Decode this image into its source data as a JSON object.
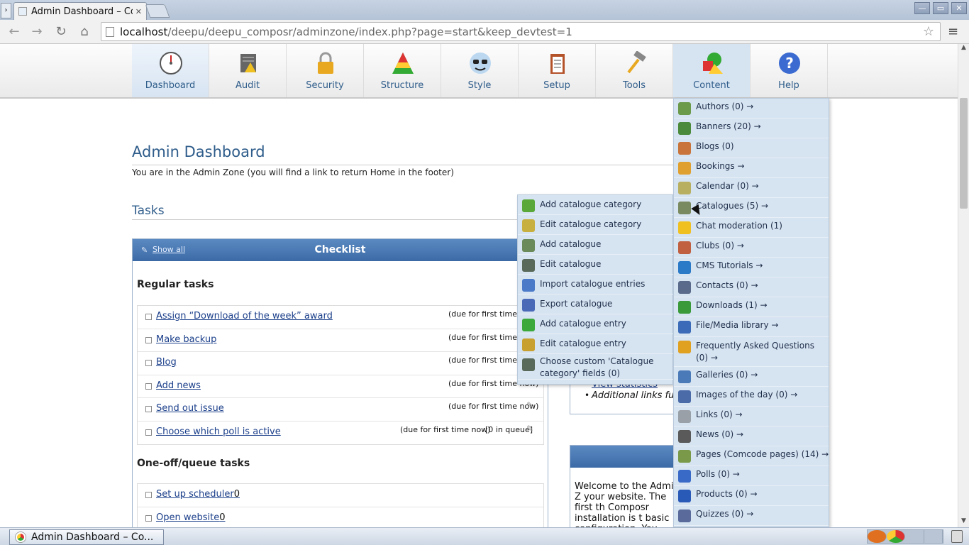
{
  "browser": {
    "tab_title": "Admin Dashboard – Co",
    "url_host": "localhost",
    "url_path": "/deepu/deepu_composr/adminzone/index.php?page=start&keep_devtest=1",
    "window_buttons": [
      "—",
      "▭",
      "✕"
    ]
  },
  "admin_nav": [
    {
      "label": "Dashboard",
      "icon": "dashboard-gauge-icon"
    },
    {
      "label": "Audit",
      "icon": "audit-icon"
    },
    {
      "label": "Security",
      "icon": "padlock-icon"
    },
    {
      "label": "Structure",
      "icon": "structure-triangle-icon"
    },
    {
      "label": "Style",
      "icon": "style-sunglasses-icon"
    },
    {
      "label": "Setup",
      "icon": "setup-clipboard-icon"
    },
    {
      "label": "Tools",
      "icon": "tools-hammer-icon"
    },
    {
      "label": "Content",
      "icon": "content-shapes-icon"
    },
    {
      "label": "Help",
      "icon": "help-question-icon"
    }
  ],
  "page": {
    "title": "Admin Dashboard",
    "subtitle": "You are in the Admin Zone (you will find a link to return Home in the footer)",
    "tasks_heading": "Tasks"
  },
  "checklist": {
    "show_all": "Show all",
    "title": "Checklist",
    "regular_heading": "Regular tasks",
    "regular_tasks": [
      {
        "label": "Assign “Download of the week” award",
        "due": "(due for first time now)",
        "queue": ""
      },
      {
        "label": "Make backup",
        "due": "(due for first time now)",
        "queue": ""
      },
      {
        "label": "Blog",
        "due": "(due for first time now)",
        "queue": ""
      },
      {
        "label": "Add news",
        "due": "(due for first time now)",
        "queue": ""
      },
      {
        "label": "Send out issue",
        "due": "(due for first time now)",
        "queue": ""
      },
      {
        "label": "Choose which poll is active",
        "due": "(due for first time now)",
        "queue": "[0 in queue]"
      }
    ],
    "oneoff_heading": "One-off/queue tasks",
    "oneoff_tasks": [
      {
        "label": "Set up scheduler",
        "count": "0"
      },
      {
        "label": "Open website",
        "count": "0"
      }
    ]
  },
  "right_panel": {
    "link_view_stats": "View statistics",
    "additional_links": "Additional links fu",
    "welcome_text": "Welcome to the Admin Z your website. The first th Composr installation is t basic configuration. You"
  },
  "content_menu": [
    {
      "label": "Authors (0) →",
      "icon": "authors-icon",
      "color": "#6a9a4a"
    },
    {
      "label": "Banners (20) →",
      "icon": "banners-icon",
      "color": "#4a8a3a"
    },
    {
      "label": "Blogs (0)",
      "icon": "blogs-icon",
      "color": "#c8743a"
    },
    {
      "label": "Bookings →",
      "icon": "bookings-icon",
      "color": "#e0a030"
    },
    {
      "label": "Calendar (0) →",
      "icon": "calendar-icon",
      "color": "#b8b060"
    },
    {
      "label": "Catalogues (5) →",
      "icon": "catalogues-icon",
      "color": "#7a8a60"
    },
    {
      "label": "Chat moderation (1)",
      "icon": "chat-icon",
      "color": "#f0c020"
    },
    {
      "label": "Clubs (0) →",
      "icon": "clubs-icon",
      "color": "#c06040"
    },
    {
      "label": "CMS Tutorials →",
      "icon": "tutorials-icon",
      "color": "#2a7ac8"
    },
    {
      "label": "Contacts (0) →",
      "icon": "contacts-icon",
      "color": "#5a6a8a"
    },
    {
      "label": "Downloads (1) →",
      "icon": "downloads-icon",
      "color": "#3a9a3a"
    },
    {
      "label": "File/Media library →",
      "icon": "media-library-icon",
      "color": "#3a6ab8"
    },
    {
      "label": "Frequently Asked Questions (0) →",
      "icon": "faq-icon",
      "color": "#e0a020"
    },
    {
      "label": "Galleries (0) →",
      "icon": "galleries-icon",
      "color": "#4a7ab8"
    },
    {
      "label": "Images of the day (0) →",
      "icon": "iotd-icon",
      "color": "#4a6aa8"
    },
    {
      "label": "Links (0) →",
      "icon": "links-icon",
      "color": "#9aa0a8"
    },
    {
      "label": "News (0) →",
      "icon": "news-icon",
      "color": "#5a5a5a"
    },
    {
      "label": "Pages (Comcode pages) (14) →",
      "icon": "pages-icon",
      "color": "#7a9a4a"
    },
    {
      "label": "Polls (0) →",
      "icon": "polls-icon",
      "color": "#3a6ac8"
    },
    {
      "label": "Products (0) →",
      "icon": "products-icon",
      "color": "#2a5ab8"
    },
    {
      "label": "Quizzes (0) →",
      "icon": "quizzes-icon",
      "color": "#5a6a9a"
    }
  ],
  "catalogue_submenu": [
    {
      "label": "Add catalogue category",
      "icon": "add-category-icon",
      "color": "#5aa83a"
    },
    {
      "label": "Edit catalogue category",
      "icon": "edit-category-icon",
      "color": "#c8b040"
    },
    {
      "label": "Add catalogue",
      "icon": "add-catalogue-icon",
      "color": "#6a8a5a"
    },
    {
      "label": "Edit catalogue",
      "icon": "edit-catalogue-icon",
      "color": "#5a6a5a"
    },
    {
      "label": "Import catalogue entries",
      "icon": "import-icon",
      "color": "#4a7ac8"
    },
    {
      "label": "Export catalogue",
      "icon": "export-icon",
      "color": "#4a6ab8"
    },
    {
      "label": "Add catalogue entry",
      "icon": "add-entry-icon",
      "color": "#3aa83a"
    },
    {
      "label": "Edit catalogue entry",
      "icon": "edit-entry-icon",
      "color": "#c8a030"
    },
    {
      "label": "Choose custom 'Catalogue category' fields (0)",
      "icon": "custom-fields-icon",
      "color": "#5a6a5a"
    }
  ],
  "taskbar": {
    "window_label": "Admin Dashboard – Co..."
  }
}
